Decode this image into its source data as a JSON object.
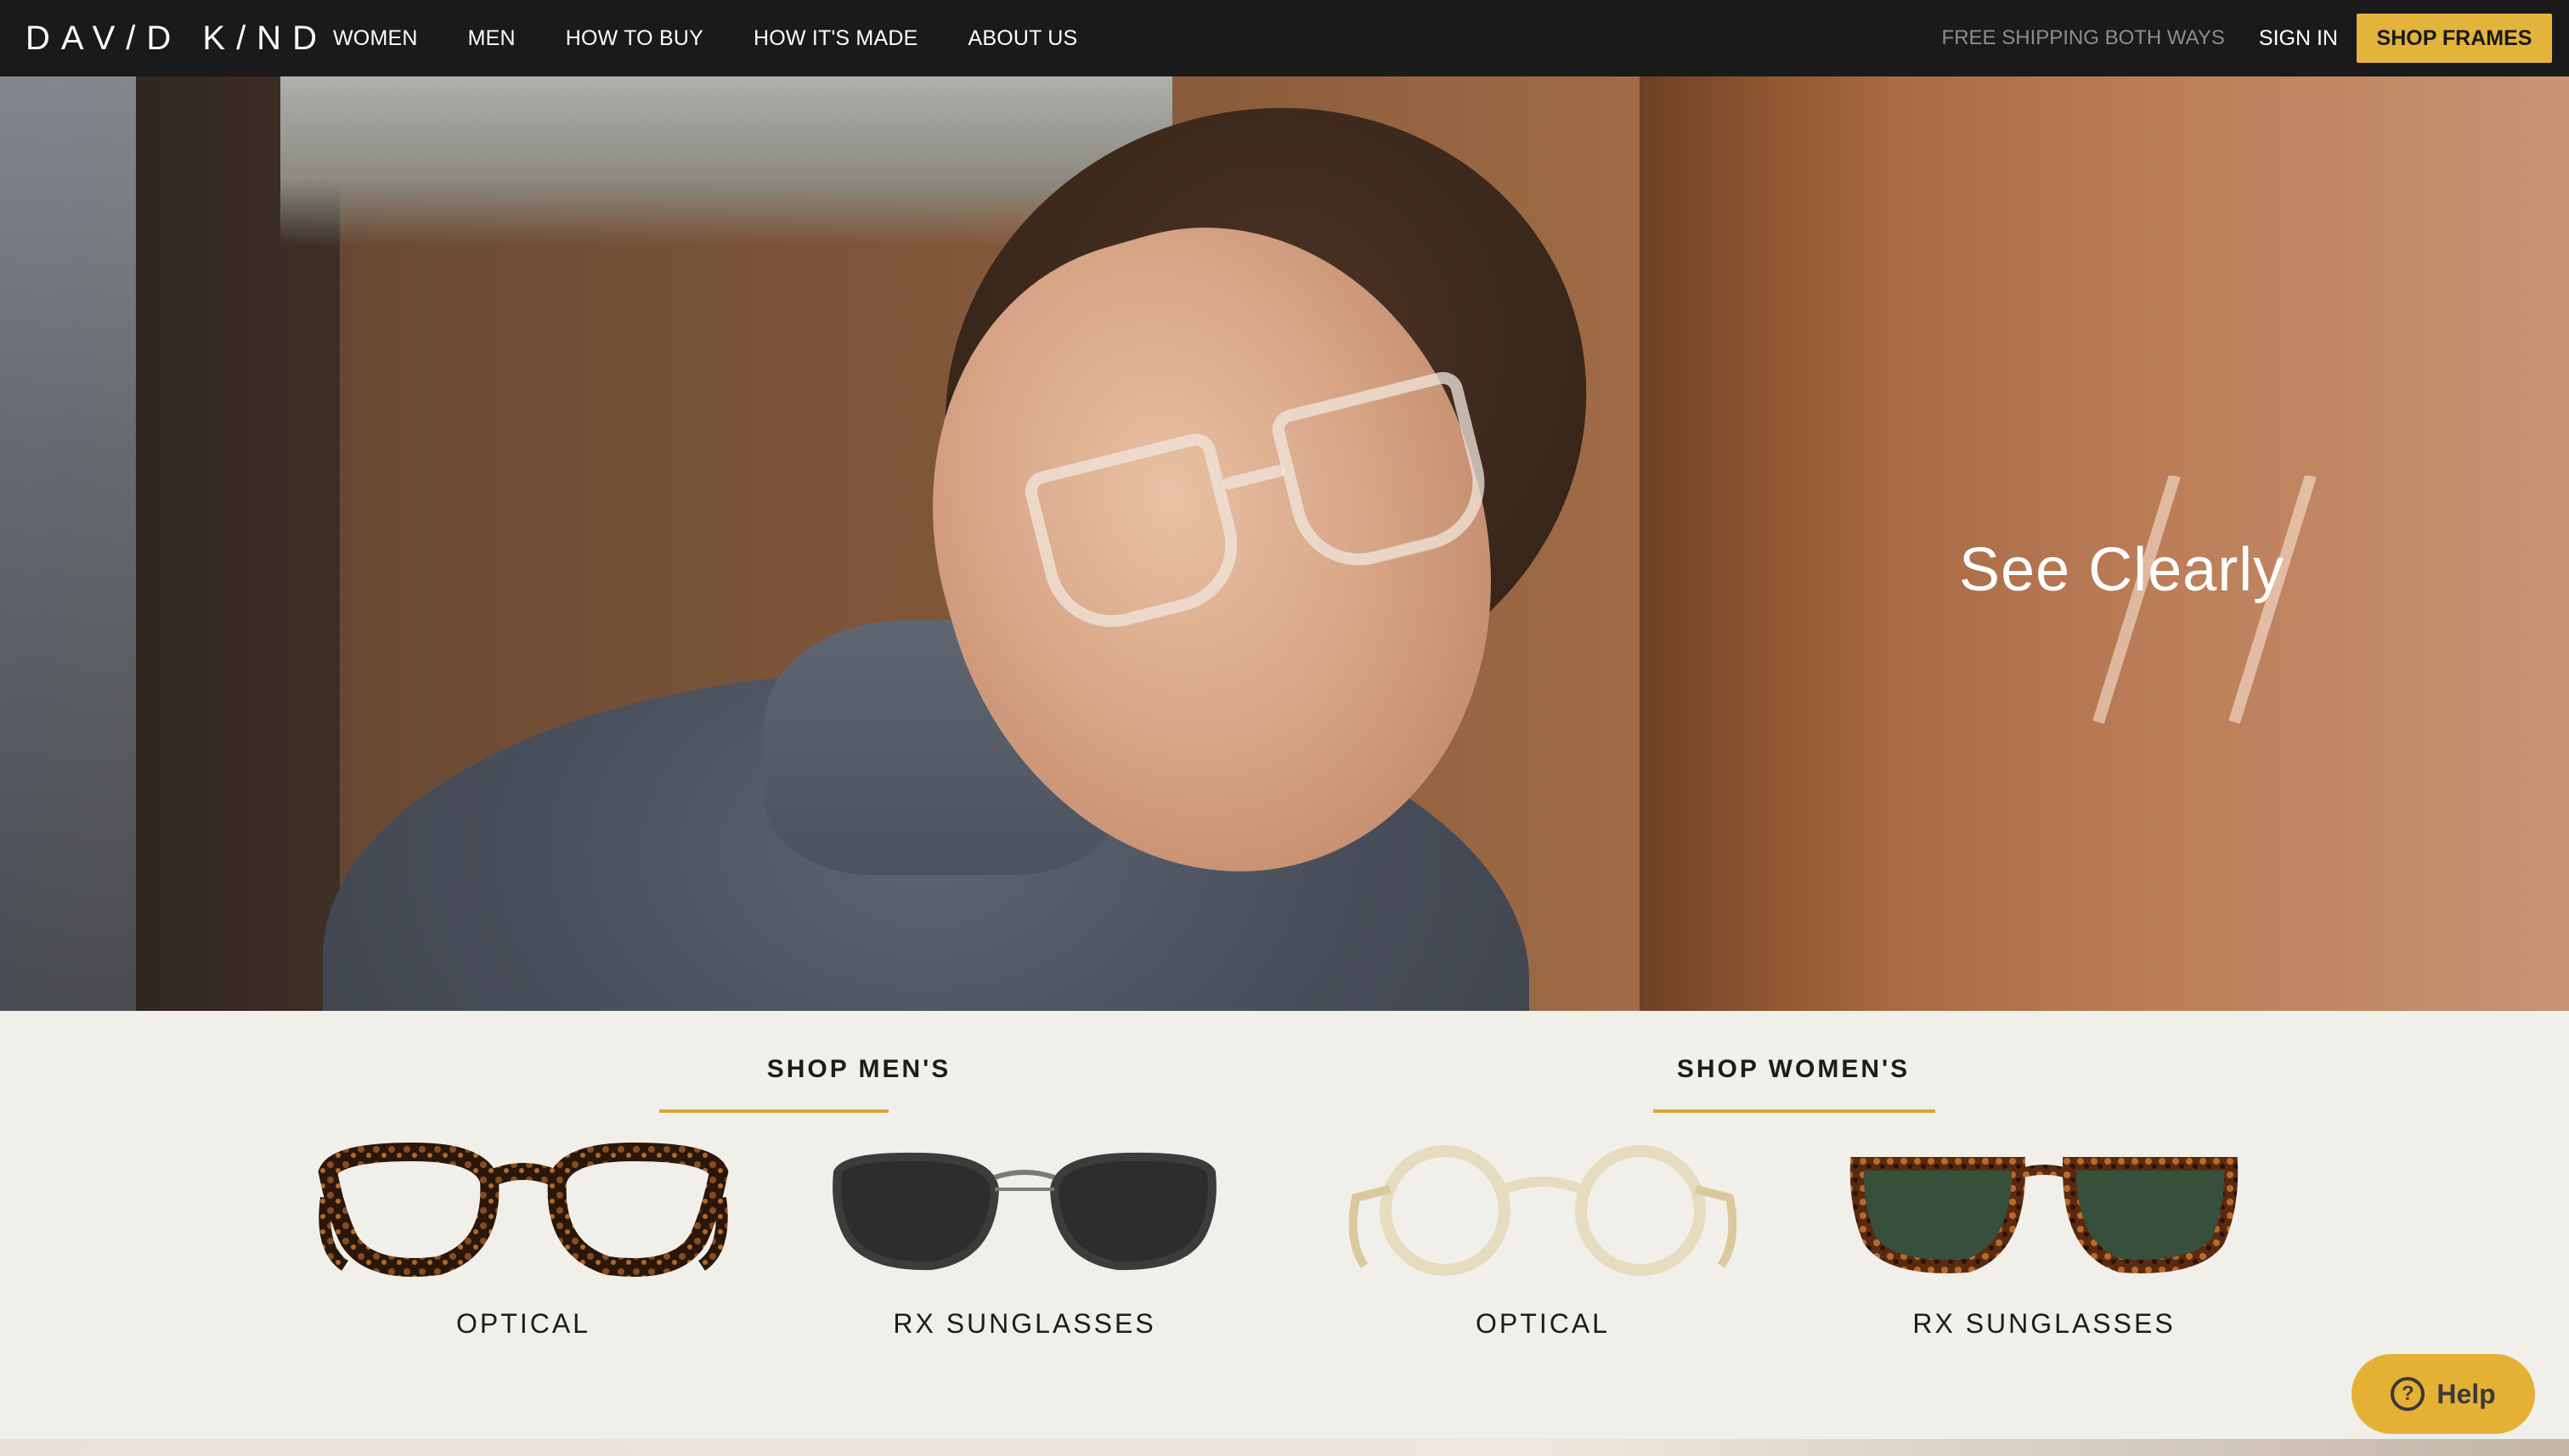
{
  "nav": {
    "logo": "DAV/D K/ND",
    "links": [
      "WOMEN",
      "MEN",
      "HOW TO BUY",
      "HOW IT'S MADE",
      "ABOUT US"
    ],
    "shipping_note": "FREE SHIPPING BOTH WAYS",
    "sign_in": "SIGN IN",
    "shop_frames": "SHOP FRAMES"
  },
  "hero": {
    "headline": "See Clearly"
  },
  "shop": {
    "men": {
      "title": "SHOP MEN'S",
      "products": [
        {
          "label": "OPTICAL",
          "icon": "tortoise-optical-frames-icon"
        },
        {
          "label": "RX SUNGLASSES",
          "icon": "black-sunglasses-icon"
        }
      ]
    },
    "women": {
      "title": "SHOP WOMEN'S",
      "products": [
        {
          "label": "OPTICAL",
          "icon": "clear-optical-frames-icon"
        },
        {
          "label": "RX SUNGLASSES",
          "icon": "tortoise-sunglasses-icon"
        }
      ]
    }
  },
  "help": {
    "label": "Help"
  },
  "colors": {
    "nav_bg": "#1a1a1a",
    "accent": "#e2b43c",
    "section_bg": "#f0efea"
  }
}
